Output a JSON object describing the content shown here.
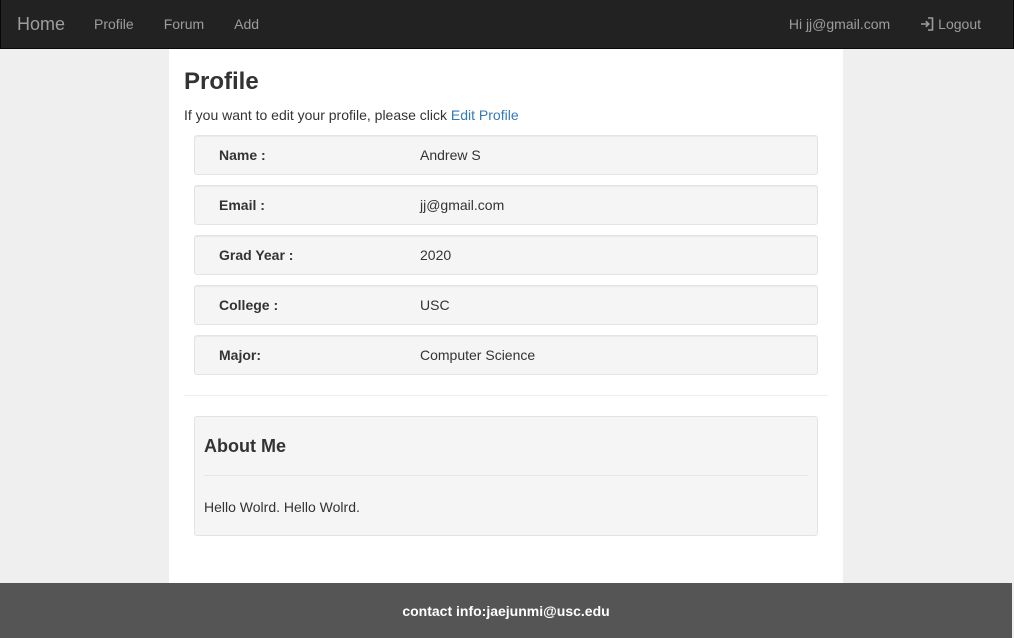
{
  "nav": {
    "brand": "Home",
    "links": [
      "Profile",
      "Forum",
      "Add"
    ],
    "greeting": "Hi jj@gmail.com",
    "logout_label": "Logout",
    "logout_icon": "log-in-icon"
  },
  "profile": {
    "title": "Profile",
    "intro_text": "If you want to edit your profile, please click",
    "edit_link": "Edit Profile",
    "fields": [
      {
        "label": "Name :",
        "value": "Andrew S"
      },
      {
        "label": "Email :",
        "value": "jj@gmail.com"
      },
      {
        "label": "Grad Year :",
        "value": "2020"
      },
      {
        "label": "College :",
        "value": "USC"
      },
      {
        "label": "Major:",
        "value": "Computer Science"
      }
    ],
    "about": {
      "title": "About Me",
      "text": "Hello Wolrd. Hello Wolrd."
    }
  },
  "footer": {
    "contact": "contact info:jaejunmi@usc.edu"
  },
  "colors": {
    "navbar": "#222222",
    "link": "#337ab7",
    "footer": "#555555"
  }
}
